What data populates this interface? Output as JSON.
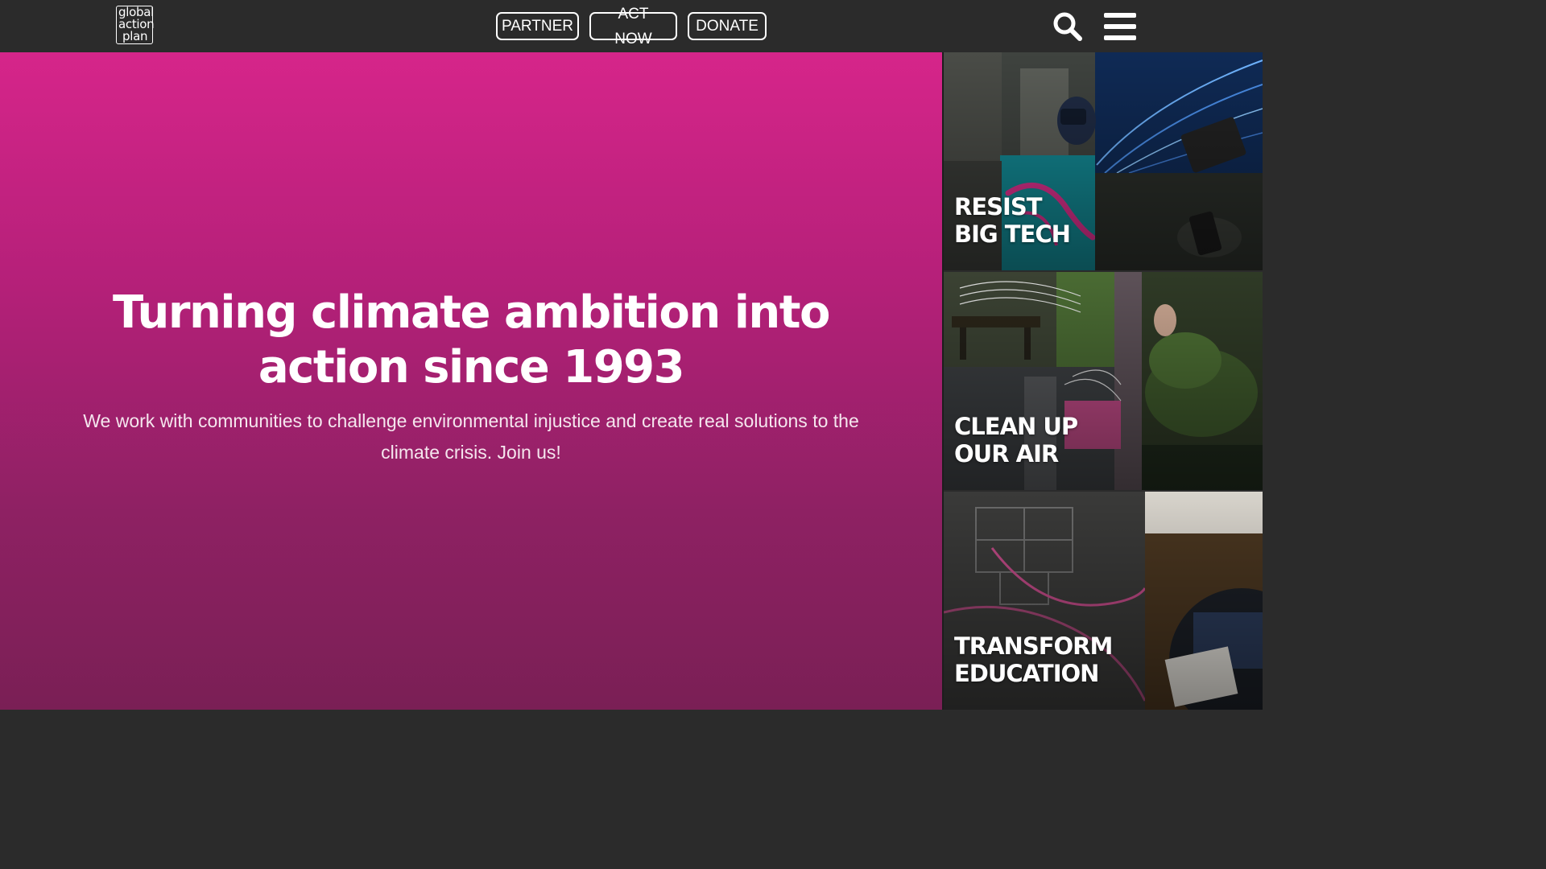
{
  "header": {
    "logo": {
      "line1": "global",
      "line2": "action",
      "line3": "plan"
    },
    "buttons": {
      "partner": "PARTNER",
      "act_now": "ACT NOW",
      "donate": "DONATE"
    },
    "icons": {
      "search": "search-icon",
      "menu": "hamburger-menu-icon"
    }
  },
  "hero": {
    "title": "Turning climate ambition into action since 1993",
    "subtitle": "We work with communities to challenge environmental injustice and create real solutions to the climate crisis. Join us!"
  },
  "tiles": [
    {
      "line1": "RESIST",
      "line2": "BIG TECH"
    },
    {
      "line1": "CLEAN UP",
      "line2": "OUR AIR"
    },
    {
      "line1": "TRANSFORM",
      "line2": "EDUCATION"
    }
  ],
  "colors": {
    "header_bg": "#2b2b2b",
    "hero_gradient_top": "#d6258a",
    "hero_gradient_bottom": "#7a1f55",
    "accent_pink": "#e0318f"
  }
}
